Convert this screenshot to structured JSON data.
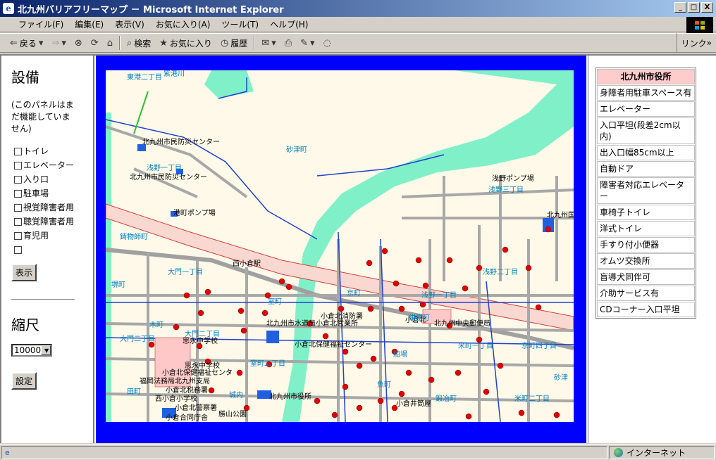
{
  "window": {
    "title": "北九州バリアフリーマップ － Microsoft Internet Explorer",
    "min_label": "_",
    "max_label": "□",
    "close_label": "X"
  },
  "menu": [
    "ファイル(F)",
    "編集(E)",
    "表示(V)",
    "お気に入り(A)",
    "ツール(T)",
    "ヘルプ(H)"
  ],
  "toolbar": {
    "back": "戻る",
    "search": "検索",
    "favorites": "お気に入り",
    "history": "履歴",
    "links": "リンク"
  },
  "left_panel": {
    "heading": "設備",
    "note": "(このパネルはまだ機能していません)",
    "checkboxes": [
      "トイレ",
      "エレベーター",
      "入り口",
      "駐車場",
      "視覚障害者用",
      "聴覚障害者用",
      "育児用",
      ""
    ],
    "show_button": "表示",
    "scale_heading": "縮尺",
    "scale_value": "10000",
    "set_button": "設定"
  },
  "map": {
    "labels_black": [
      "北九州市民防災センター",
      "北九州市民防災センター",
      "浅野ポンプ場",
      "港町ポンプ場",
      "北九州国",
      "西小倉駅",
      "北九州市水道局小倉北営業所",
      "小倉北消防署",
      "小倉北保健福祉センター",
      "北九州中央郵便局",
      "小倉北",
      "思永中学校",
      "思永中学校",
      "小倉北保健福祉センタ",
      "福岡法務局北九州支局",
      "小倉北税務署",
      "西小倉小学校",
      "北九州市役所",
      "小倉北警察署",
      "小倉井筒屋",
      "小倉合同庁舎",
      "勝山公園"
    ],
    "labels_blue": [
      "東港二丁目",
      "紫港川",
      "浅野一丁目",
      "浅野三丁目",
      "砂津町",
      "鋳物師町",
      "大門一丁目",
      "浅野二丁目",
      "堺町",
      "京町",
      "浅野一丁目",
      "室町",
      "木町",
      "紺屋町",
      "大門二丁目",
      "京町四丁目",
      "米町二丁目",
      "城内",
      "船場",
      "魚町",
      "鍛冶町",
      "大門二丁目",
      "室町二丁目",
      "田町",
      "米町一丁目",
      "砂津"
    ]
  },
  "info_panel": {
    "title": "北九州市役所",
    "items": [
      "身障者用駐車スペース有",
      "エレベーター",
      "入口平坦(段差2cm以内)",
      "出入口幅85cm以上",
      "自動ドア",
      "障害者対応エレベーター",
      "車椅子トイレ",
      "洋式トイレ",
      "手すり付小便器",
      "オムツ交換所",
      "盲導犬同伴可",
      "介助サービス有",
      "CDコーナー入口平坦"
    ]
  },
  "status": {
    "zone": "インターネット"
  }
}
